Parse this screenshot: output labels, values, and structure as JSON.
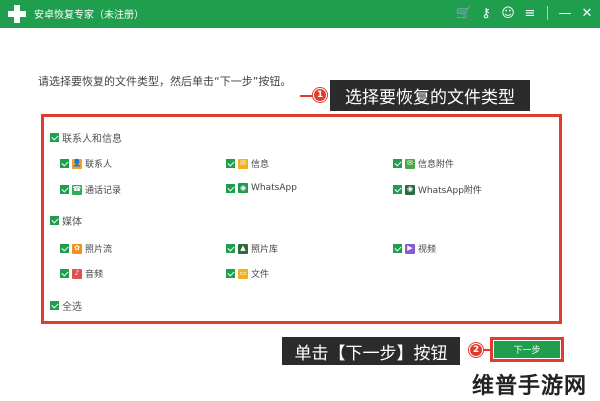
{
  "app": {
    "title": "安卓恢复专家（未注册）",
    "accent": "#1f9e4d"
  },
  "titlebar_icons": [
    {
      "name": "cart-icon",
      "glyph": "🛒"
    },
    {
      "name": "key-icon",
      "glyph": "⚷"
    },
    {
      "name": "chat-icon",
      "glyph": "☺"
    },
    {
      "name": "menu-icon",
      "glyph": "≡"
    },
    {
      "name": "minimize-icon",
      "glyph": "—"
    },
    {
      "name": "close-icon",
      "glyph": "✕"
    }
  ],
  "instruction": "请选择要恢复的文件类型，然后单击“下一步”按钮。",
  "callout1": {
    "badge": "1",
    "text": "选择要恢复的文件类型"
  },
  "groups": {
    "contacts_messages": {
      "label": "联系人和信息",
      "options": [
        {
          "label": "联系人",
          "icon": "contacts-icon",
          "color": "#f0a030"
        },
        {
          "label": "信息",
          "icon": "message-icon",
          "color": "#f0b020"
        },
        {
          "label": "信息附件",
          "icon": "attachment-icon",
          "color": "#4aa84a"
        },
        {
          "label": "通话记录",
          "icon": "phone-icon",
          "color": "#2fae5a"
        },
        {
          "label": "WhatsApp",
          "icon": "whatsapp-icon",
          "color": "#1d9a4a"
        },
        {
          "label": "WhatsApp附件",
          "icon": "whatsapp-attachment-icon",
          "color": "#2a6b40"
        }
      ]
    },
    "media": {
      "label": "媒体",
      "options": [
        {
          "label": "照片流",
          "icon": "photo-stream-icon",
          "color": "#f09020"
        },
        {
          "label": "照片库",
          "icon": "photo-library-icon",
          "color": "#2f6b3a"
        },
        {
          "label": "视频",
          "icon": "video-icon",
          "color": "#8a5ad0"
        },
        {
          "label": "音频",
          "icon": "audio-icon",
          "color": "#e05050"
        },
        {
          "label": "文件",
          "icon": "file-icon",
          "color": "#f0b020"
        }
      ]
    },
    "select_all": {
      "label": "全选"
    }
  },
  "callout2": {
    "badge": "2",
    "text": "单击【下一步】按钮"
  },
  "next_button": "下一步",
  "watermark": "维普手游网",
  "colors": {
    "highlight_red": "#e23b2e",
    "callout_dark": "#2b2b2b"
  }
}
